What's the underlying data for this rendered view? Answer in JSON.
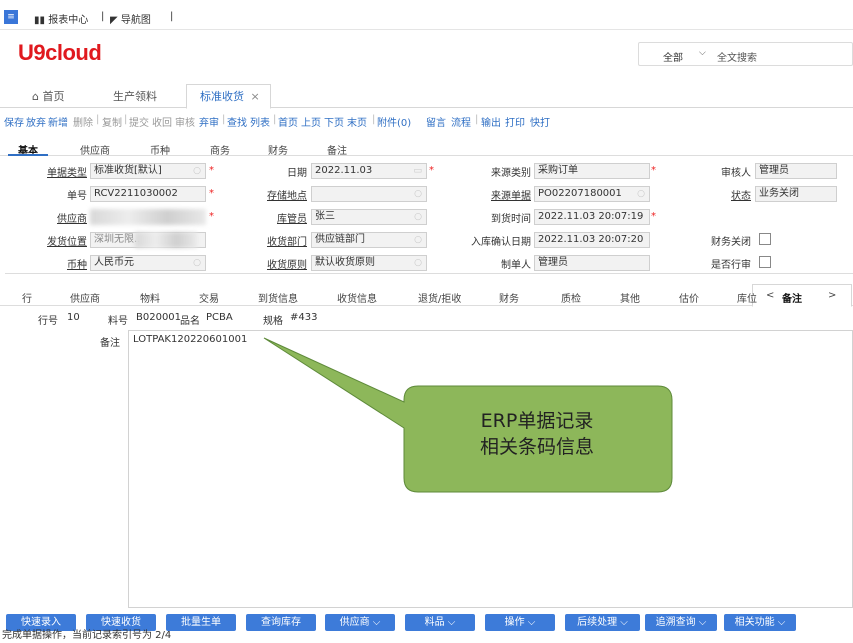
{
  "topbar": {
    "menu_glyph": "≡",
    "report_center": "报表中心",
    "navigator": "导航图"
  },
  "brand": {
    "logo": "U9cloud",
    "color": "#e0191e"
  },
  "search": {
    "scope": "全部",
    "placeholder": "全文搜索"
  },
  "tabs": [
    {
      "label": "首页",
      "icon": "home-icon"
    },
    {
      "label": "生产领料"
    },
    {
      "label": "标准收货",
      "active": true
    }
  ],
  "tab_close": "×",
  "toolbar": [
    "保存",
    "放弃",
    "新增",
    "删除",
    "复制",
    "提交",
    "收回",
    "审核",
    "弃审",
    "查找",
    "列表",
    "首页",
    "上页",
    "下页",
    "末页",
    "附件(0)",
    "留言",
    "流程",
    "输出",
    "打印",
    "快打"
  ],
  "section_tabs": [
    "基本",
    "供应商",
    "币种",
    "商务",
    "财务",
    "备注"
  ],
  "form": {
    "doc_type": {
      "label": "单据类型",
      "value": "标准收货[默认]"
    },
    "doc_no": {
      "label": "单号",
      "value": "RCV2211030002"
    },
    "supplier": {
      "label": "供应商",
      "value": ""
    },
    "ship_loc": {
      "label": "发货位置",
      "value": "深圳无限..."
    },
    "currency": {
      "label": "币种",
      "value": "人民币元"
    },
    "date": {
      "label": "日期",
      "value": "2022.11.03"
    },
    "storage_loc": {
      "label": "存储地点",
      "value": ""
    },
    "keeper": {
      "label": "库管员",
      "value": "张三"
    },
    "recv_dept": {
      "label": "收货部门",
      "value": "供应链部门"
    },
    "recv_rule": {
      "label": "收货原则",
      "value": "默认收货原则"
    },
    "source_type": {
      "label": "来源类别",
      "value": "采购订单"
    },
    "source_doc": {
      "label": "来源单据",
      "value": "PO02207180001"
    },
    "arrive_time": {
      "label": "到货时间",
      "value": "2022.11.03 20:07:19"
    },
    "inbound_confirm": {
      "label": "入库确认日期",
      "value": "2022.11.03 20:07:20"
    },
    "maker": {
      "label": "制单人",
      "value": "管理员"
    },
    "auditor": {
      "label": "审核人",
      "value": "管理员"
    },
    "status": {
      "label": "状态",
      "value": "业务关闭"
    },
    "fin_close": {
      "label": "财务关闭"
    },
    "line_audit": {
      "label": "是否行审"
    }
  },
  "line_tabs": [
    "行",
    "供应商",
    "物料",
    "交易",
    "到货信息",
    "收货信息",
    "退货/拒收",
    "财务",
    "质检",
    "其他",
    "估价",
    "库位",
    "备注"
  ],
  "line_nav": {
    "prev": "<",
    "next": ">"
  },
  "detail": {
    "line_label": "行号",
    "line_no": "10",
    "item_label": "料号",
    "item_no": "B020001",
    "name_label": "品名",
    "name": "PCBA",
    "spec_label": "规格",
    "spec": "#433",
    "note_label": "备注",
    "note": "LOTPAK120220601001"
  },
  "callout": {
    "line1": "ERP单据记录",
    "line2": "相关条码信息",
    "fill": "#8db75a"
  },
  "bottom_buttons": [
    "快速录入",
    "快速收货",
    "批量生单",
    "查询库存",
    "供应商 ⌵",
    "料品 ⌵",
    "操作 ⌵",
    "后续处理 ⌵",
    "追溯查询 ⌵",
    "相关功能 ⌵"
  ],
  "status_text": "完成单据操作，当前记录索引号为 2/4"
}
